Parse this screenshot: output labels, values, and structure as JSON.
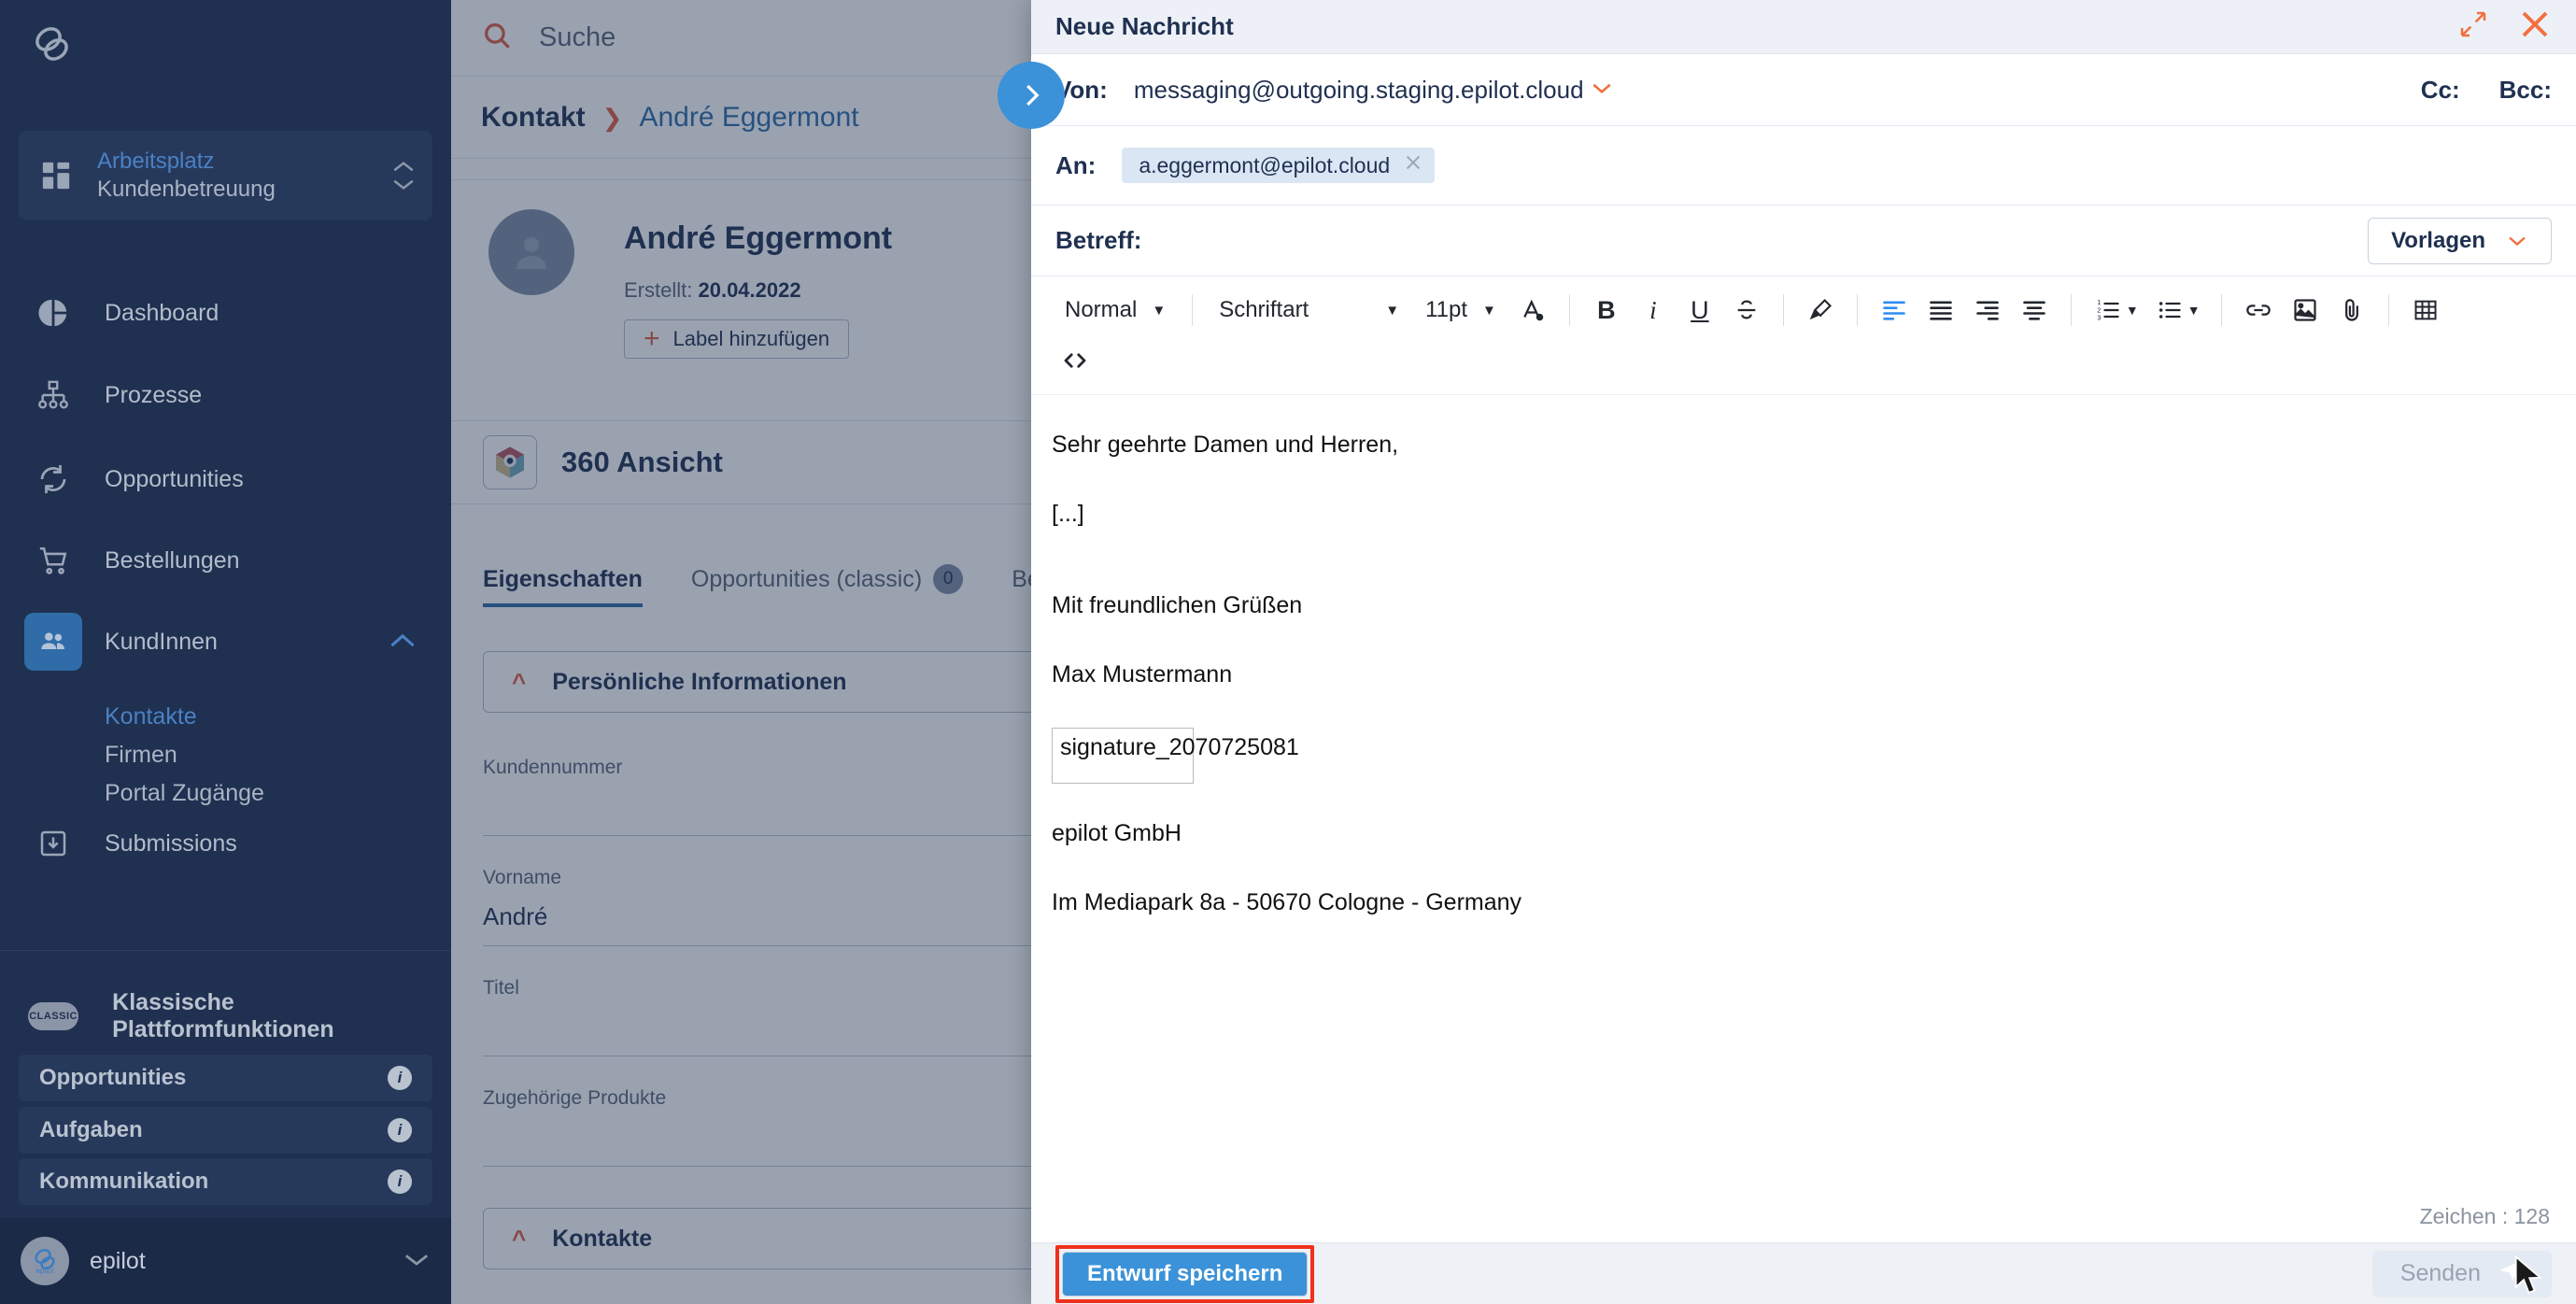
{
  "sidebar": {
    "logo_icon": "epilot-logo-icon",
    "workspace": {
      "title": "Arbeitsplatz",
      "subtitle": "Kundenbetreuung",
      "icon": "grid-icon",
      "chevron_icon": "chevron-updown-icon"
    },
    "items": [
      {
        "label": "Dashboard",
        "icon": "pie-chart-icon"
      },
      {
        "label": "Prozesse",
        "icon": "workflow-icon"
      },
      {
        "label": "Opportunities",
        "icon": "refresh-cycle-icon"
      },
      {
        "label": "Bestellungen",
        "icon": "shopping-cart-icon"
      },
      {
        "label": "KundInnen",
        "icon": "users-icon"
      }
    ],
    "sub_items": [
      {
        "label": "Kontakte",
        "selected": true
      },
      {
        "label": "Firmen",
        "selected": false
      },
      {
        "label": "Portal Zugänge",
        "selected": false
      }
    ],
    "submissions": {
      "label": "Submissions",
      "icon": "inbox-download-icon"
    },
    "classic": {
      "badge": "CLASSIC",
      "heading": "Klassische Plattformfunktionen",
      "items": [
        {
          "label": "Opportunities",
          "info_icon": "info-icon"
        },
        {
          "label": "Aufgaben",
          "info_icon": "info-icon"
        },
        {
          "label": "Kommunikation",
          "info_icon": "info-icon"
        }
      ]
    },
    "footer": {
      "org": "epilot",
      "avatar_icon": "epilot-avatar-icon",
      "chevron_icon": "chevron-down-icon"
    }
  },
  "main": {
    "search": {
      "placeholder": "Suche",
      "icon": "search-icon"
    },
    "breadcrumb": {
      "root": "Kontakt",
      "separator_icon": "chevron-right-icon",
      "current": "André Eggermont"
    },
    "contact": {
      "avatar_icon": "person-avatar-icon",
      "name": "André Eggermont",
      "created_label": "Erstellt:",
      "created_value": "20.04.2022",
      "add_label_button": "Label hinzufügen",
      "add_label_icon": "plus-icon"
    },
    "view360": {
      "title": "360 Ansicht",
      "icon": "cube-360-icon"
    },
    "tabs": [
      {
        "label": "Eigenschaften",
        "active": true,
        "count": null
      },
      {
        "label": "Opportunities (classic)",
        "active": false,
        "count": "0"
      },
      {
        "label": "Bezie",
        "active": false,
        "count": null
      }
    ],
    "sections": [
      {
        "title": "Persönliche Informationen",
        "chevron_icon": "chevron-up-icon"
      },
      {
        "title": "Kontakte",
        "chevron_icon": "chevron-up-icon"
      }
    ],
    "fields": [
      {
        "label": "Kundennummer",
        "value": ""
      },
      {
        "label": "Vorname",
        "value": "André"
      },
      {
        "label": "Titel",
        "value": ""
      },
      {
        "label": "Zugehörige Produkte",
        "value": ""
      }
    ],
    "panel_toggle_icon": "chevron-right-circle-icon"
  },
  "modal": {
    "title": "Neue Nachricht",
    "expand_icon": "expand-diagonal-icon",
    "close_icon": "close-x-icon",
    "from": {
      "label": "Von:",
      "value": "messaging@outgoing.staging.epilot.cloud",
      "chevron_icon": "chevron-down-icon"
    },
    "cc_label": "Cc:",
    "bcc_label": "Bcc:",
    "to": {
      "label": "An:",
      "chip": "a.eggermont@epilot.cloud",
      "chip_remove_icon": "close-x-icon"
    },
    "subject": {
      "label": "Betreff:",
      "value": ""
    },
    "templates_button": {
      "label": "Vorlagen",
      "chevron_icon": "chevron-down-icon"
    },
    "toolbar": {
      "style_select": "Normal",
      "font_select": "Schriftart",
      "size_select": "11pt",
      "buttons": [
        {
          "name": "text-color-icon",
          "glyph": "A"
        },
        {
          "name": "bold-icon",
          "glyph": "B"
        },
        {
          "name": "italic-icon",
          "glyph": "i"
        },
        {
          "name": "underline-icon",
          "glyph": "U"
        },
        {
          "name": "strikethrough-icon",
          "glyph": "S"
        },
        {
          "name": "highlight-icon",
          "glyph": "pen"
        },
        {
          "name": "align-left-icon",
          "glyph": "align-left"
        },
        {
          "name": "align-center-icon",
          "glyph": "align-center"
        },
        {
          "name": "align-right-icon",
          "glyph": "align-right"
        },
        {
          "name": "align-justify-icon",
          "glyph": "align-justify"
        },
        {
          "name": "ordered-list-icon",
          "glyph": "ol"
        },
        {
          "name": "unordered-list-icon",
          "glyph": "ul"
        },
        {
          "name": "link-icon",
          "glyph": "link"
        },
        {
          "name": "image-icon",
          "glyph": "image"
        },
        {
          "name": "attachment-icon",
          "glyph": "clip"
        },
        {
          "name": "table-icon",
          "glyph": "table"
        },
        {
          "name": "code-icon",
          "glyph": "<>"
        }
      ]
    },
    "body": {
      "lines": [
        "Sehr geehrte Damen und Herren,",
        "[...]",
        "Mit freundlichen Grüßen",
        "Max Mustermann"
      ],
      "signature_placeholder": "signature_2070725081",
      "footer_lines": [
        "epilot GmbH",
        "Im Mediapark 8a - 50670 Cologne - Germany"
      ]
    },
    "char_count": "Zeichen : 128",
    "save_draft_button": "Entwurf speichern",
    "send_button": {
      "label": "Senden",
      "icon": "send-paper-plane-icon"
    }
  },
  "colors": {
    "sidebar_bg": "#1f3050",
    "accent_blue": "#3b92d8",
    "accent_orange": "#f2703f",
    "highlight_red": "#f0301c",
    "chip_bg": "#dbe6f5"
  }
}
